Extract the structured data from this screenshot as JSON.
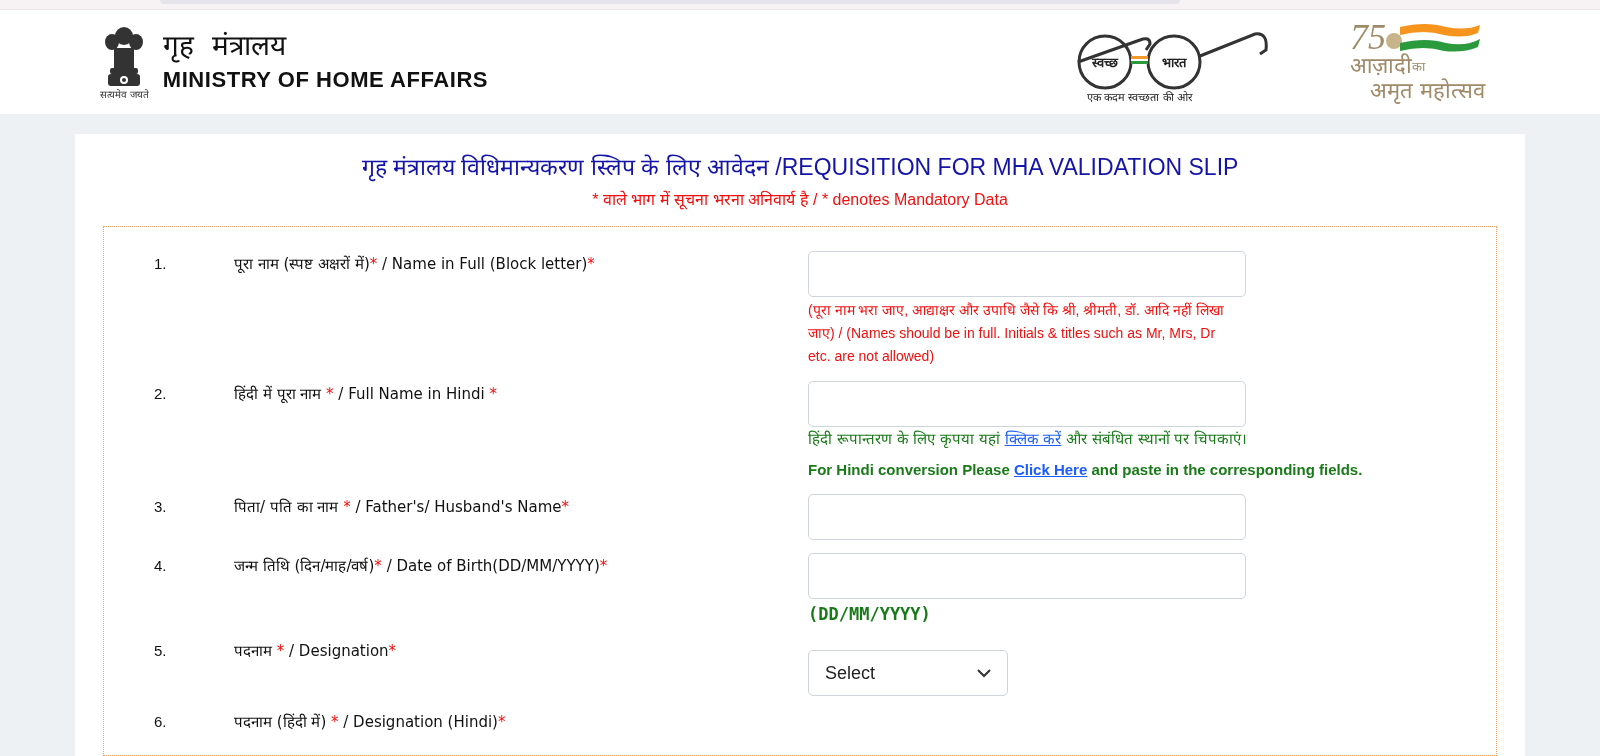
{
  "header": {
    "emblem_motto": "सत्यमेव जयते",
    "ministry_hindi": "गृह  मंत्रालय",
    "ministry_english": "MINISTRY OF HOME AFFAIRS",
    "swachh": {
      "left": "स्वच्छ",
      "right": "भारत",
      "tagline": "एक कदम स्वच्छता की ओर"
    },
    "azadi": {
      "number": "75",
      "line1": "आज़ादी",
      "small": "का",
      "line2": "अमृत महोत्सव"
    }
  },
  "form": {
    "title": "गृह मंत्रालय विधिमान्यकरण स्लिप के लिए आवेदन /REQUISITION FOR MHA VALIDATION SLIP",
    "subtitle": "* वाले भाग में सूचना भरना अनिवार्य है / * denotes Mandatory Data",
    "rows": [
      {
        "number": "1.",
        "label": [
          {
            "text": "पूरा नाम (स्पष्ट अक्षरों में)",
            "required": false
          },
          {
            "text": "*",
            "required": true
          },
          {
            "text": " / Name in Full (Block letter)",
            "required": false
          },
          {
            "text": "*",
            "required": true
          }
        ],
        "field": {
          "kind": "text"
        },
        "hints": [
          {
            "kind": "warning",
            "parts": [
              {
                "text": "(पूरा नाम भरा जाए, आद्याक्षर और उपाधि जैसे कि श्री, श्रीमती, डॉ. आदि नहीं लिखा जाए) / (Names should be in full. Initials & titles such as Mr, Mrs, Dr etc. are not allowed)",
                "link": false
              }
            ]
          }
        ]
      },
      {
        "number": "2.",
        "label": [
          {
            "text": "हिंदी में पूरा नाम ",
            "required": false
          },
          {
            "text": "*",
            "required": true
          },
          {
            "text": " / Full Name in Hindi ",
            "required": false
          },
          {
            "text": "*",
            "required": true
          }
        ],
        "field": {
          "kind": "text"
        },
        "hints": [
          {
            "kind": "info",
            "parts": [
              {
                "text": "हिंदी रूपान्तरण के लिए कृपया यहां ",
                "link": false
              },
              {
                "text": "क्लिक करें",
                "link": true
              },
              {
                "text": " और संबंधित स्थानों पर चिपकाएं।",
                "link": false
              }
            ]
          },
          {
            "kind": "info_bold",
            "parts": [
              {
                "text": "For Hindi conversion Please ",
                "link": false
              },
              {
                "text": "Click Here",
                "link": true
              },
              {
                "text": "  and paste in the corresponding fields.",
                "link": false
              }
            ]
          }
        ]
      },
      {
        "number": "3.",
        "label": [
          {
            "text": "पिता/ पति का नाम ",
            "required": false
          },
          {
            "text": "*",
            "required": true
          },
          {
            "text": " / Father's/ Husband's Name",
            "required": false
          },
          {
            "text": "*",
            "required": true
          }
        ],
        "field": {
          "kind": "text"
        },
        "hints": []
      },
      {
        "number": "4.",
        "label": [
          {
            "text": "जन्म तिथि (दिन/माह/वर्ष)",
            "required": false
          },
          {
            "text": "*",
            "required": true
          },
          {
            "text": " / Date of Birth(DD/MM/YYYY)",
            "required": false
          },
          {
            "text": "*",
            "required": true
          }
        ],
        "field": {
          "kind": "text"
        },
        "hints": [
          {
            "kind": "format",
            "parts": [
              {
                "text": "(DD/MM/YYYY)",
                "link": false
              }
            ]
          }
        ]
      },
      {
        "number": "5.",
        "label": [
          {
            "text": "पदनाम ",
            "required": false
          },
          {
            "text": "*",
            "required": true
          },
          {
            "text": " / Designation",
            "required": false
          },
          {
            "text": "*",
            "required": true
          }
        ],
        "field": {
          "kind": "select",
          "value": "Select"
        },
        "hints": []
      },
      {
        "number": "6.",
        "label": [
          {
            "text": "पदनाम (हिंदी में) ",
            "required": false
          },
          {
            "text": "*",
            "required": true
          },
          {
            "text": " / Designation (Hindi)",
            "required": false
          },
          {
            "text": "*",
            "required": true
          }
        ],
        "hints": []
      }
    ]
  }
}
